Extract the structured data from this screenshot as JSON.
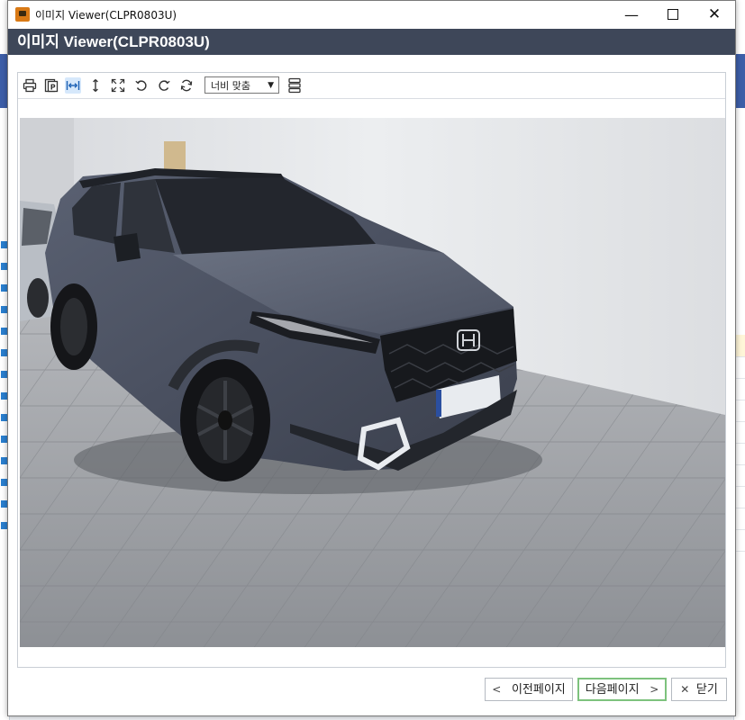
{
  "window": {
    "title": "이미지 Viewer(CLPR0803U)",
    "controls": {
      "minimize": "—",
      "maximize": "",
      "close": "✕"
    }
  },
  "header": {
    "title": "이미지 Viewer(CLPR0803U)"
  },
  "toolbar": {
    "icons": [
      "print-icon",
      "page-icon",
      "fit-width-icon",
      "fit-height-icon",
      "fullscreen-icon",
      "rotate-left-icon",
      "rotate-right-icon",
      "refresh-icon",
      "thumbnail-layout-icon"
    ],
    "zoom": {
      "selected": "너비 맞춤",
      "arrow": "▼"
    }
  },
  "viewer": {
    "image": {
      "subject": "dark gray SUV in a parking garage",
      "colors": {
        "wall": "#e4e6e9",
        "floor": "#9c9fa4",
        "car_body": "#4b5262",
        "car_dark": "#2a2e36"
      }
    }
  },
  "footer": {
    "prev_label": "이전페이지",
    "prev_chevron": "<",
    "next_label": "다음페이지",
    "next_chevron": ">",
    "close_label": "닫기",
    "close_icon": "✕"
  },
  "colors": {
    "header_bg": "#3e4759",
    "next_border": "#7dc27d",
    "active_icon_bg": "#d6e8fb"
  }
}
